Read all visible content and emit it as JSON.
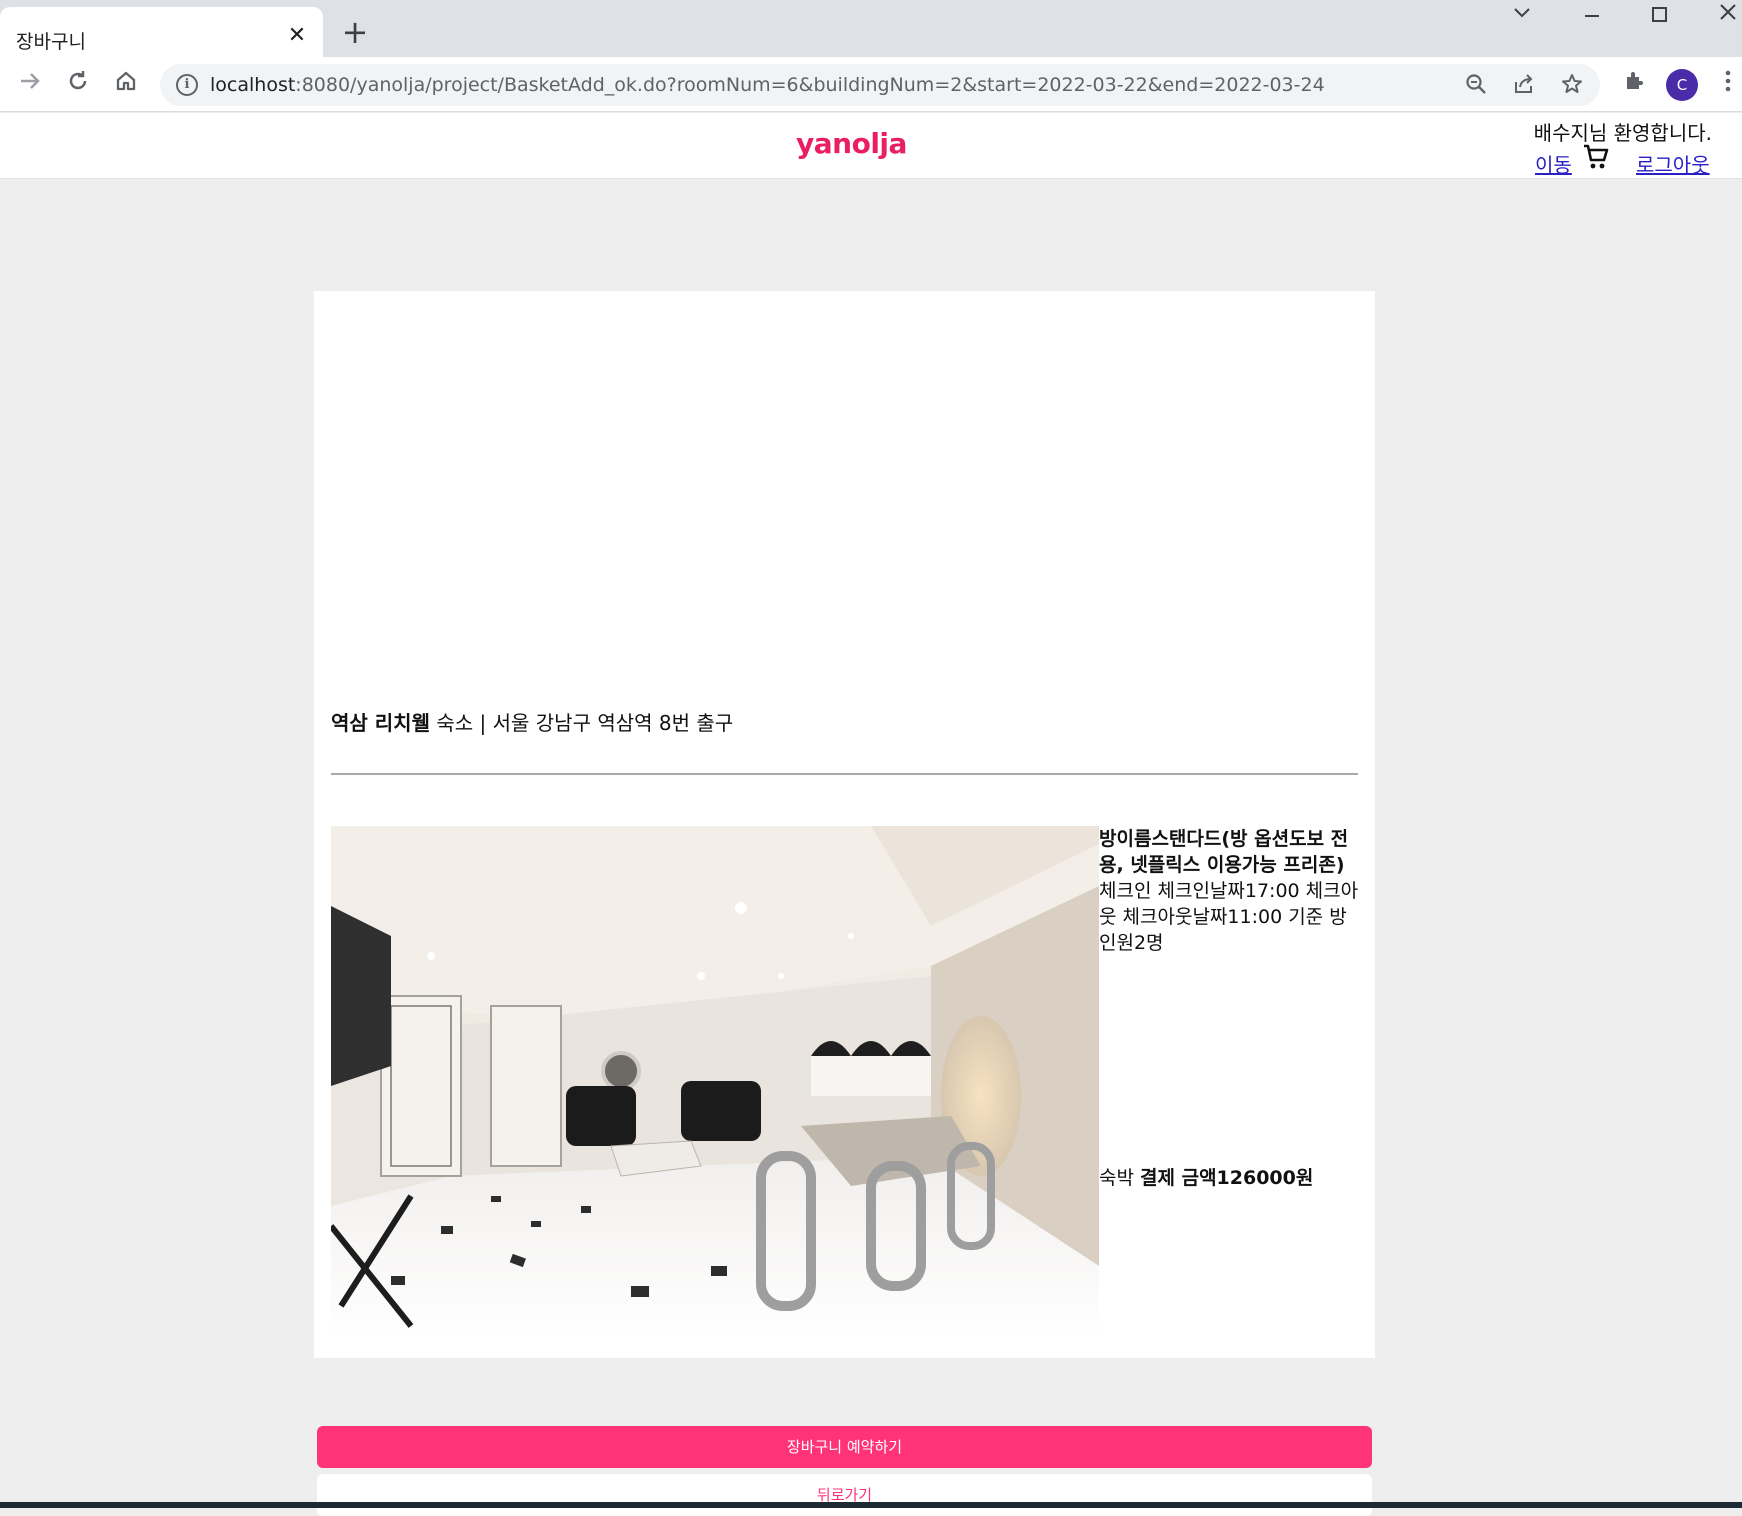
{
  "browser": {
    "tab_title": "장바구니",
    "tab_close": "✕",
    "new_tab": "+",
    "url_host": "localhost",
    "url_path": ":8080/yanolja/project/BasketAdd_ok.do?roomNum=6&buildingNum=2&start=2022-03-22&end=2022-03-24",
    "profile_initial": "C",
    "icons": [
      "back-icon",
      "forward-icon",
      "reload-icon",
      "home-icon",
      "info-icon",
      "zoom-icon",
      "share-icon",
      "star-icon",
      "extensions-icon",
      "menu-icon"
    ]
  },
  "header": {
    "logo": "yanolja",
    "welcome": "배수지님 환영합니다.",
    "move_link": "이동",
    "logout_link": "로그아웃"
  },
  "building": {
    "name": "역삼 리치웰",
    "category": "숙소",
    "separator": "|",
    "address": "서울 강남구 역삼역 8번 출구"
  },
  "room": {
    "name": "방이름스탠다드(방 옵션도보 전용, 넷플릭스 이용가능 프리존)",
    "details": "체크인 체크인날짜17:00  체크아웃 체크아웃날짜11:00 기준 방 인원2명",
    "stay_type": "숙박",
    "price_label": "결제 금액126000원"
  },
  "buttons": {
    "reserve": "장바구니 예약하기",
    "back": "뒤로가기"
  },
  "colors": {
    "brand": "#ff3478",
    "logo": "#e91e63",
    "link": "#2a1fc4"
  }
}
